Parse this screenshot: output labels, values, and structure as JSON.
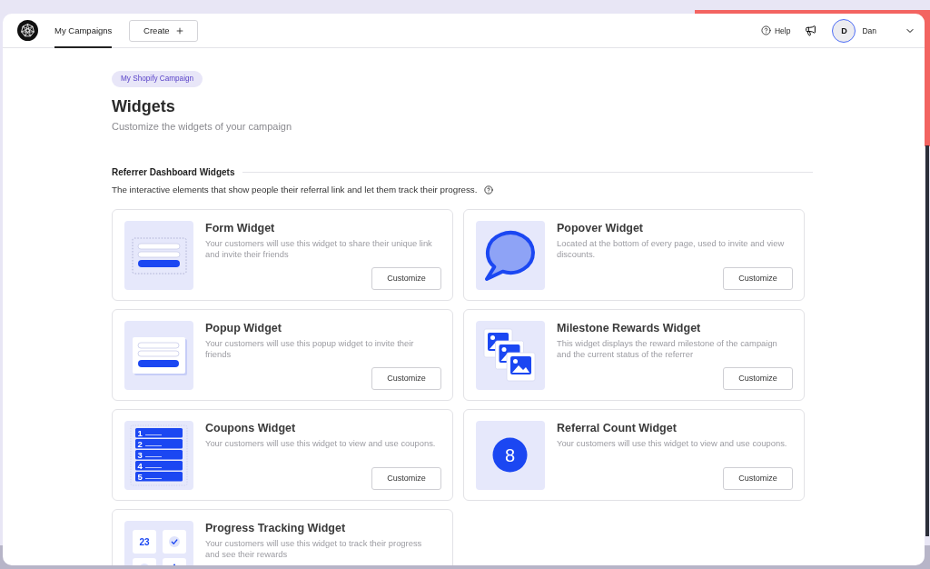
{
  "nav": {
    "tabs": [
      {
        "label": "My Campaigns",
        "selected": true
      }
    ],
    "create_button": "Create",
    "help": "Help",
    "user": {
      "initial": "D",
      "name": "Dan"
    }
  },
  "page": {
    "badge": "My Shopify Campaign",
    "title": "Widgets",
    "subtitle": "Customize the widgets of your campaign"
  },
  "section": {
    "title": "Referrer Dashboard Widgets",
    "description": "The interactive elements that show people their referral link and let them track their progress."
  },
  "widgets": [
    {
      "title": "Form Widget",
      "description": "Your customers will use this widget to share their unique link and invite their friends",
      "button": "Customize",
      "preview": {
        "kind": "form"
      }
    },
    {
      "title": "Popover Widget",
      "description": "Located at the bottom of every page, used to invite and view discounts.",
      "button": "Customize",
      "preview": {
        "kind": "popover"
      }
    },
    {
      "title": "Popup Widget",
      "description": "Your customers will use this popup widget to invite their friends",
      "button": "Customize",
      "preview": {
        "kind": "popup"
      }
    },
    {
      "title": "Milestone Rewards Widget",
      "description": "This widget displays the reward milestone of the campaign and the current status of the referrer",
      "button": "Customize",
      "preview": {
        "kind": "milestone"
      }
    },
    {
      "title": "Coupons Widget",
      "description": "Your customers will use this widget to view and use coupons.",
      "button": "Customize",
      "preview": {
        "kind": "coupons",
        "numbers": [
          "1",
          "2",
          "3",
          "4",
          "5"
        ]
      }
    },
    {
      "title": "Referral Count Widget",
      "description": "Your customers will use this widget to view and use coupons.",
      "button": "Customize",
      "preview": {
        "kind": "count",
        "value": "8"
      }
    },
    {
      "title": "Progress Tracking Widget",
      "description": "Your customers will use this widget to track their progress and see their rewards",
      "preview": {
        "kind": "progress",
        "value": "23"
      }
    }
  ]
}
